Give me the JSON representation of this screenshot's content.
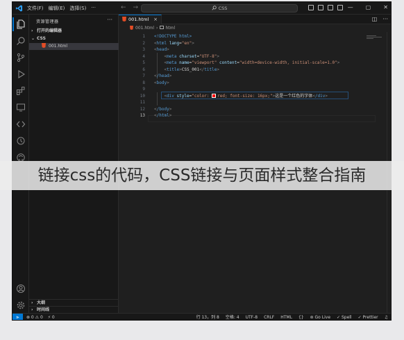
{
  "titlebar": {
    "menu": [
      "文件(F)",
      "编辑(E)",
      "选择(S)",
      "···"
    ],
    "command_center": "CSS",
    "win_controls": [
      "—",
      "▢",
      "✕"
    ]
  },
  "sidebar": {
    "header": "资源管理器",
    "more": "···",
    "open_editors": "打开的编辑器",
    "folder": "CSS",
    "file": "001.html",
    "outline": "大纲",
    "timeline": "时间线"
  },
  "editor": {
    "tab_label": "001.html",
    "tab_close": "×",
    "breadcrumb_file": "001.html",
    "breadcrumb_symbol": "html",
    "cursor_line": 13,
    "lines": [
      {
        "n": "1"
      },
      {
        "n": "2"
      },
      {
        "n": "3"
      },
      {
        "n": "4"
      },
      {
        "n": "5"
      },
      {
        "n": "6"
      },
      {
        "n": "7"
      },
      {
        "n": "8"
      },
      {
        "n": "9"
      },
      {
        "n": "10"
      },
      {
        "n": "11"
      },
      {
        "n": "12"
      },
      {
        "n": "13"
      }
    ],
    "code": {
      "l1": "<!DOCTYPE html>",
      "l2_tag": "html",
      "l2_attr": "lang",
      "l2_val": "\"en\"",
      "l3": "head",
      "l4_tag": "meta",
      "l4_attr": "charset",
      "l4_val": "\"UTF-8\"",
      "l5_tag": "meta",
      "l5_attr1": "name",
      "l5_val1": "\"viewport\"",
      "l5_attr2": "content",
      "l5_val2": "\"width=device-width, initial-scale=1.0\"",
      "l6_tag": "title",
      "l6_text": "CSS_001",
      "l7": "/head",
      "l8": "body",
      "l10_tag": "div",
      "l10_attr": "style",
      "l10_val_a": "\"color: ",
      "l10_val_b": "red; font-size: 16px;\"",
      "l10_text": "这是一个红色的字体",
      "l10_close": "/div",
      "l12": "/body",
      "l13": "/html"
    }
  },
  "statusbar": {
    "remote": "⫸",
    "errors": "⊗ 0 ⚠ 0",
    "ports": "⚡ 0",
    "position": "行 13，列 8",
    "spaces": "空格: 4",
    "encoding": "UTF-8",
    "eol": "CRLF",
    "language": "HTML",
    "golive": "Go Live",
    "spell": "✓ Spell",
    "prettier": "✓ Prettier"
  },
  "overlay": {
    "caption": "链接css的代码，CSS链接与页面样式整合指南"
  },
  "colors": {
    "accent": "#0078d4",
    "tag": "#569cd6",
    "attribute": "#9cdcfe",
    "string": "#ce9178",
    "html_icon": "#e44d26"
  }
}
